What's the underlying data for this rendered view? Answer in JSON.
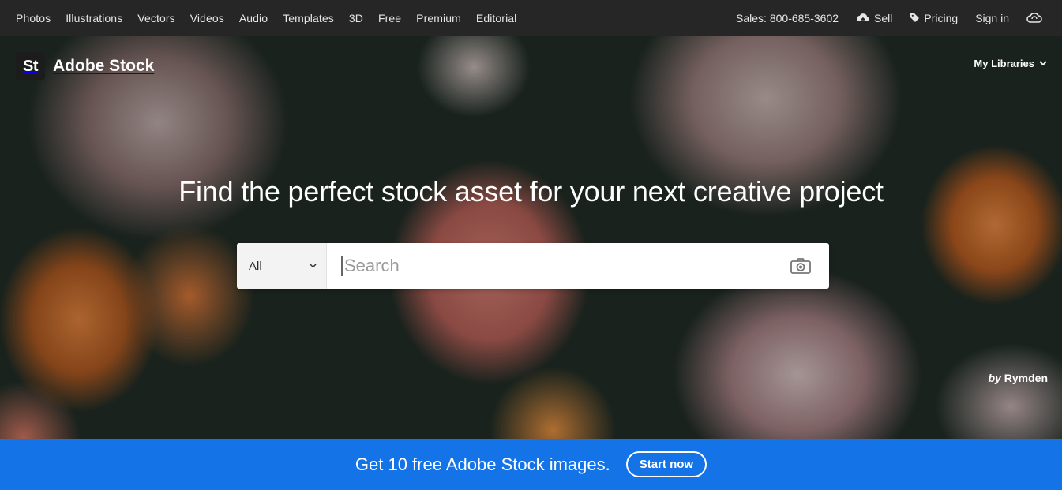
{
  "topnav": {
    "links": [
      "Photos",
      "Illustrations",
      "Vectors",
      "Videos",
      "Audio",
      "Templates",
      "3D",
      "Free",
      "Premium",
      "Editorial"
    ],
    "sales": "Sales: 800-685-3602",
    "sell": "Sell",
    "pricing": "Pricing",
    "signin": "Sign in"
  },
  "brand": {
    "logo": "St",
    "name": "Adobe Stock"
  },
  "header": {
    "my_libraries": "My Libraries"
  },
  "hero": {
    "headline": "Find the perfect stock asset for your next creative project",
    "credit_prefix": "by",
    "credit_name": "Rymden"
  },
  "search": {
    "category": "All",
    "placeholder": "Search"
  },
  "banner": {
    "message": "Get 10 free Adobe Stock images.",
    "cta": "Start now"
  },
  "colors": {
    "accent": "#1473e6",
    "nav_bg": "#262626"
  }
}
